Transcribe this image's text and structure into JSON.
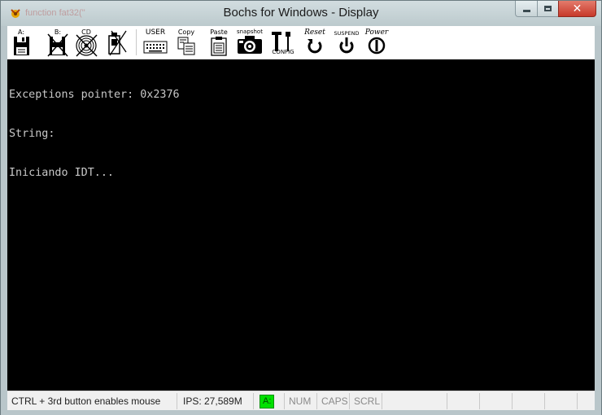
{
  "window": {
    "title": "Bochs for Windows - Display",
    "ghost_text": "function fat32(\""
  },
  "toolbar": {
    "floppy_a": "A:",
    "floppy_b": "B:",
    "cdrom": "CD",
    "user": "USER",
    "copy": "Copy",
    "paste": "Paste",
    "snapshot": "snapshot",
    "config": "CONFIG",
    "reset": "Reset",
    "suspend": "SUSPEND",
    "power": "Power"
  },
  "console": {
    "lines": [
      "Exceptions pointer: 0x2376",
      "String:",
      "Iniciando IDT..."
    ]
  },
  "statusbar": {
    "mouse_hint": "CTRL + 3rd button enables mouse",
    "ips": "IPS: 27,589M",
    "drive_a": "A:",
    "num": "NUM",
    "caps": "CAPS",
    "scrl": "SCRL"
  },
  "colors": {
    "drive_led": "#00e000",
    "console_bg": "#000000",
    "console_fg": "#c8c8c8",
    "close_button": "#c7392a"
  }
}
